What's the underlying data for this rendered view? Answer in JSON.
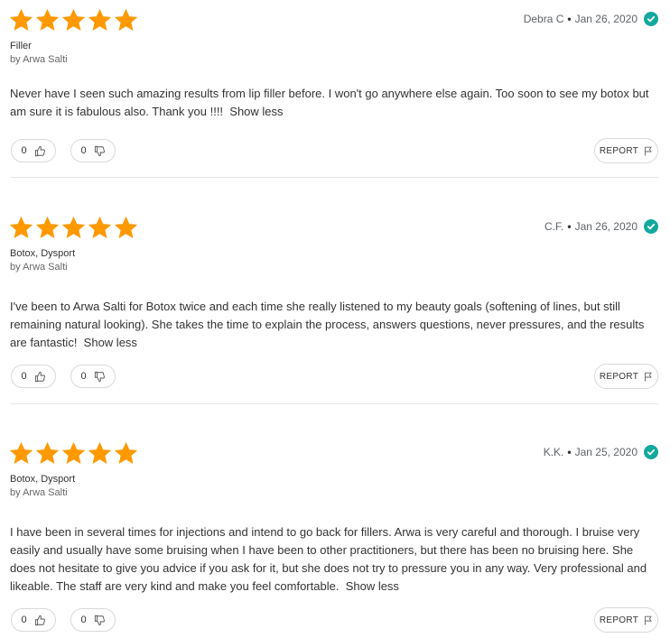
{
  "colors": {
    "star": "#ff9900",
    "verified": "#13a89e"
  },
  "reviews": [
    {
      "rating": 5,
      "author": "Debra C",
      "date": "Jan 26, 2020",
      "treatment": "Filler",
      "provider": "by Arwa Salti",
      "text": "Never have I seen such amazing results from lip filler before. I won't go anywhere else again. Too soon to see my botox but am sure it is fabulous also. Thank you !!!!",
      "show_less": "Show less",
      "helpful_count": "0",
      "unhelpful_count": "0",
      "report_label": "REPORT"
    },
    {
      "rating": 5,
      "author": "C.F.",
      "date": "Jan 26, 2020",
      "treatment": "Botox, Dysport",
      "provider": "by Arwa Salti",
      "text": "I've been to Arwa Salti for Botox twice and each time she really listened to my beauty goals (softening of lines, but still remaining natural looking). She takes the time to explain the process, answers questions, never pressures, and the results are fantastic!",
      "show_less": "Show less",
      "helpful_count": "0",
      "unhelpful_count": "0",
      "report_label": "REPORT"
    },
    {
      "rating": 5,
      "author": "K.K.",
      "date": "Jan 25, 2020",
      "treatment": "Botox, Dysport",
      "provider": "by Arwa Salti",
      "text": "I have been in several times for injections and intend to go back for fillers. Arwa is very careful and thorough. I bruise very easily and usually have some bruising when I have been to other practitioners, but there has been no bruising here. She does not hesitate to give you advice if you ask for it, but she does not try to pressure you in any way. Very professional and likeable. The staff are very kind and make you feel comfortable.",
      "show_less": "Show less",
      "helpful_count": "0",
      "unhelpful_count": "0",
      "report_label": "REPORT"
    }
  ]
}
